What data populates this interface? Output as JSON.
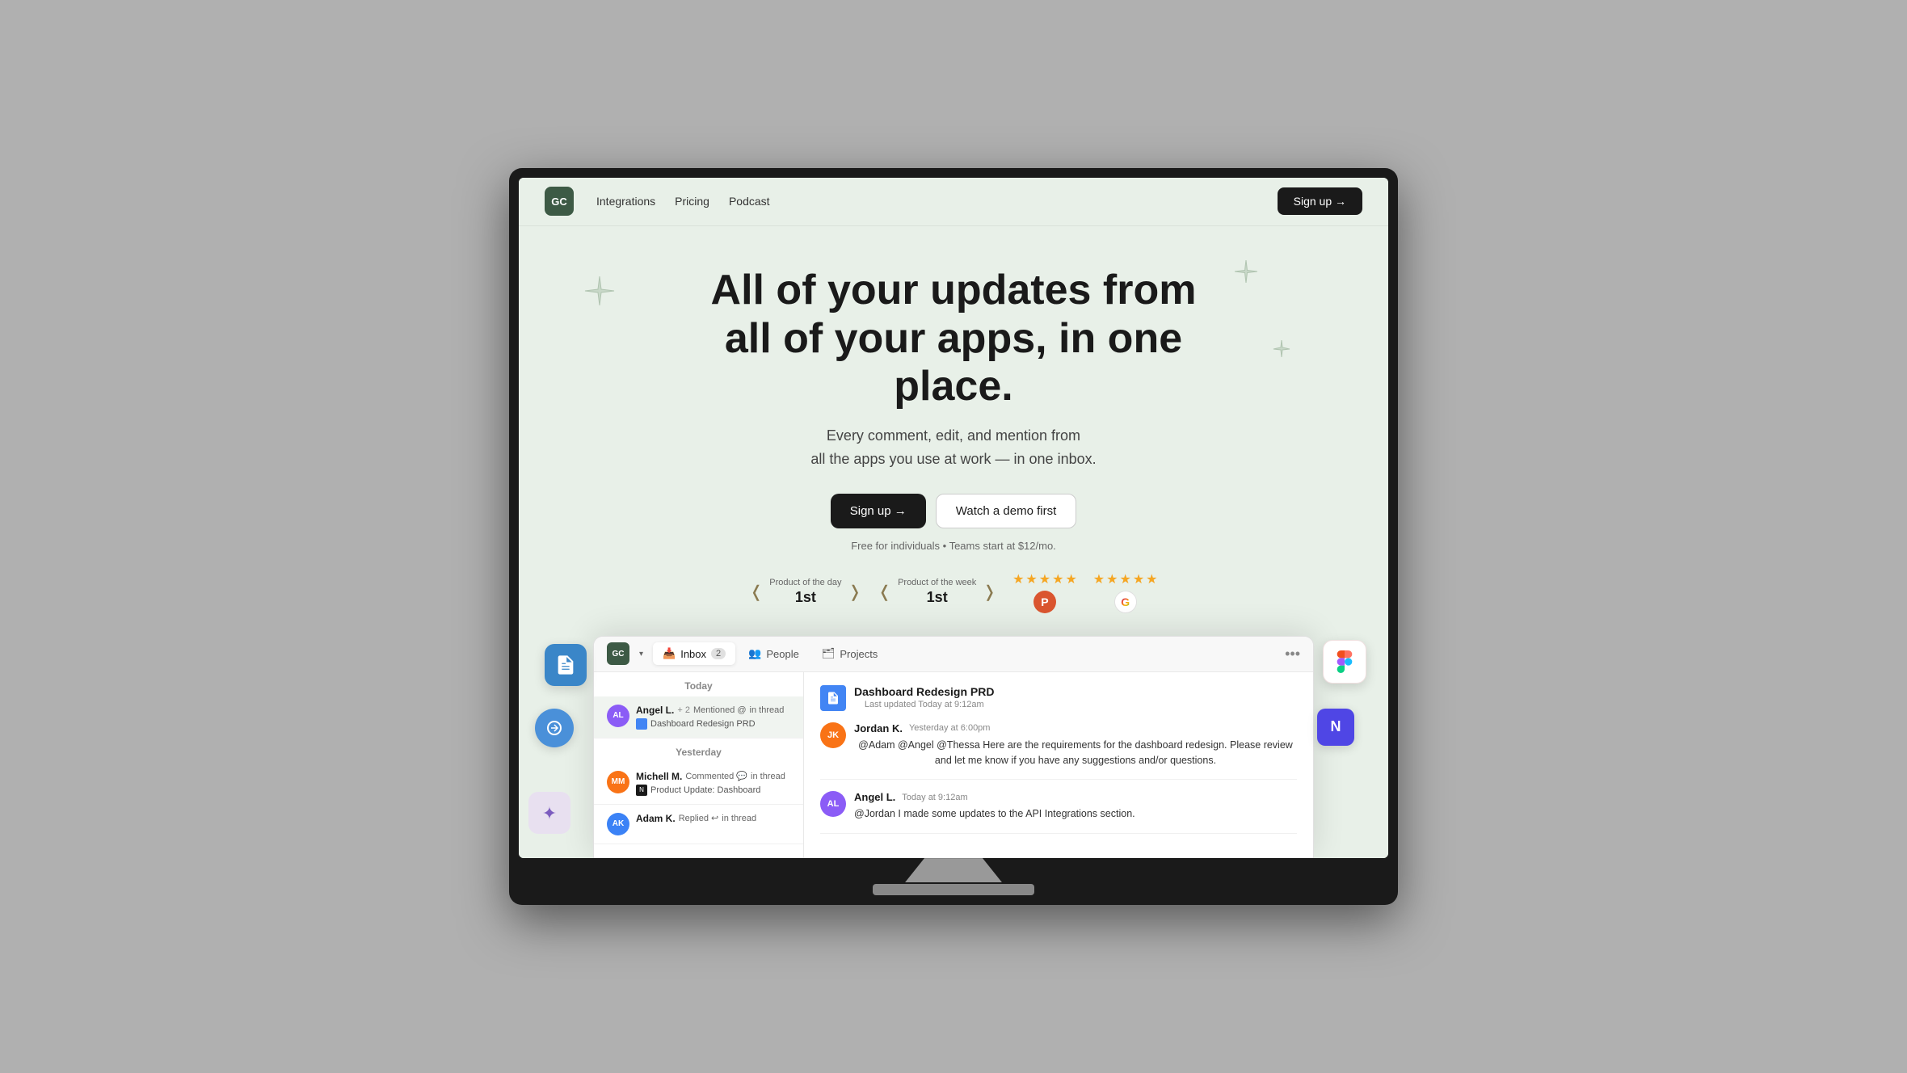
{
  "nav": {
    "logo": "GC",
    "links": [
      "Integrations",
      "Pricing",
      "Podcast"
    ],
    "signup": "Sign up →"
  },
  "hero": {
    "title_line1": "All of your updates from",
    "title_line2": "all of your apps, in one place.",
    "subtitle_line1": "Every comment, edit, and mention from",
    "subtitle_line2": "all the apps you use at work — in one inbox.",
    "cta_signup": "Sign up →",
    "cta_demo": "Watch a demo first",
    "pricing_note": "Free for individuals • Teams start at $12/mo."
  },
  "badges": {
    "product_day_label": "Product of the day",
    "product_day_rank": "1st",
    "product_week_label": "Product of the week",
    "product_week_rank": "1st",
    "ph_stars": "★★★★½",
    "g_stars": "★★★★½"
  },
  "app": {
    "logo": "GC",
    "tabs": [
      {
        "label": "Inbox",
        "badge": "2",
        "active": true
      },
      {
        "label": "People",
        "active": false
      },
      {
        "label": "Projects",
        "active": false
      }
    ],
    "more_icon": "•••",
    "inbox": {
      "today_label": "Today",
      "yesterday_label": "Yesterday",
      "items": [
        {
          "sender": "Angel L.",
          "count": "+ 2",
          "action": "Mentioned @",
          "thread": "in thread",
          "doc": "Dashboard Redesign PRD",
          "doc_type": "gdoc",
          "active": true
        },
        {
          "sender": "Michell M.",
          "action": "Commented 💬",
          "thread": "in thread",
          "doc": "Product Update: Dashboard",
          "doc_type": "notion"
        },
        {
          "sender": "Adam K.",
          "action": "Replied ↩",
          "thread": "in thread",
          "doc": ""
        }
      ]
    },
    "detail": {
      "doc_title": "Dashboard Redesign PRD",
      "doc_meta": "Last updated Today at 9:12am",
      "messages": [
        {
          "name": "Jordan K.",
          "time": "Yesterday at 6:00pm",
          "text": "@Adam @Angel @Thessa Here are the requirements for the dashboard redesign. Please review and let me know if you have any suggestions and/or questions.",
          "avatar_color": "#f97316"
        },
        {
          "name": "Angel L.",
          "time": "Today at 9:12am",
          "text": "@Jordan I made some updates to the API Integrations section.",
          "avatar_color": "#8b5cf6"
        }
      ]
    }
  }
}
